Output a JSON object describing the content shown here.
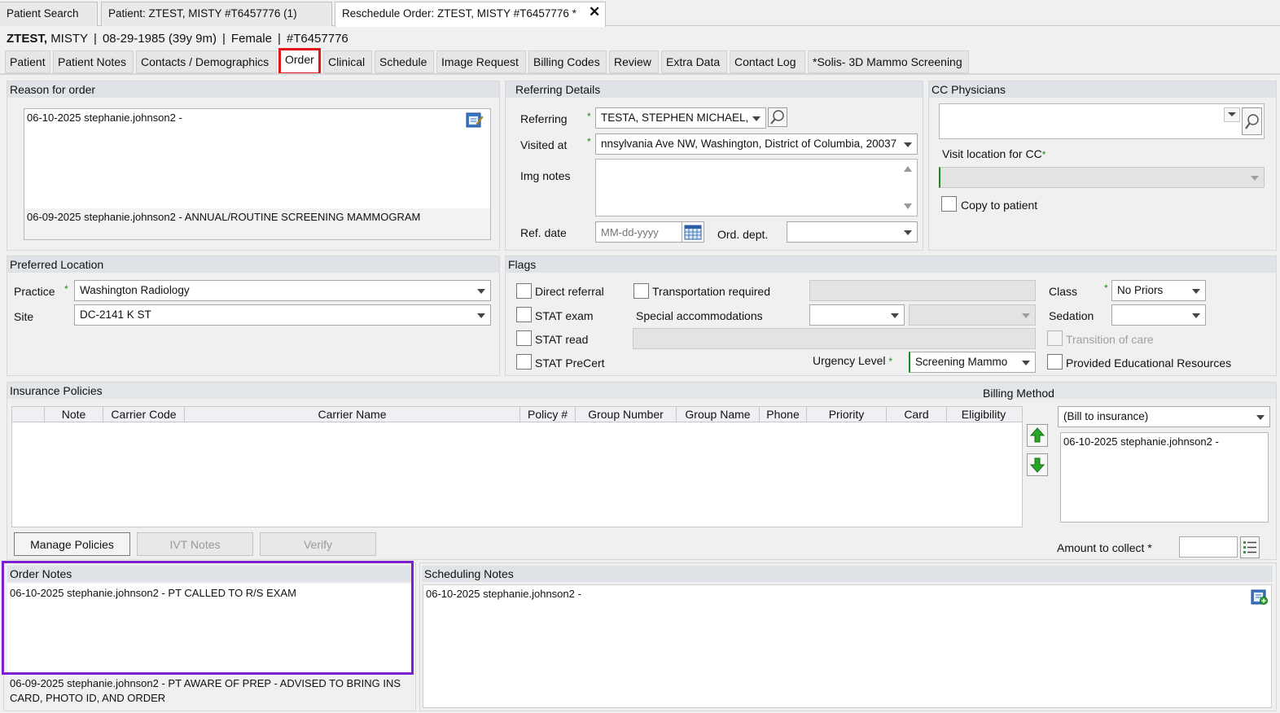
{
  "doc_tabs": [
    "Patient Search",
    "Patient: ZTEST, MISTY #T6457776 (1)",
    "Reschedule Order: ZTEST, MISTY #T6457776 *"
  ],
  "patient": {
    "last": "ZTEST,",
    "first": "MISTY",
    "dob": "08-29-1985 (39y 9m)",
    "sex": "Female",
    "id": "#T6457776",
    "sep": "|"
  },
  "sub_tabs": [
    "Patient",
    "Patient Notes",
    "Contacts / Demographics",
    "Order",
    "Clinical",
    "Schedule",
    "Image Request",
    "Billing Codes",
    "Review",
    "Extra Data",
    "Contact Log",
    "*Solis- 3D Mammo Screening"
  ],
  "reason": {
    "title": "Reason for order",
    "note1": "06-10-2025 stephanie.johnson2 -",
    "note2": "06-09-2025 stephanie.johnson2 - ANNUAL/ROUTINE SCREENING MAMMOGRAM"
  },
  "referring": {
    "title": "Referring Details",
    "referring_label": "Referring",
    "referring_value": "TESTA, STEPHEN MICHAEL,",
    "visited_label": "Visited at",
    "visited_value": "nnsylvania Ave NW, Washington, District of Columbia, 20037",
    "img_notes_label": "Img notes",
    "ref_date_label": "Ref. date",
    "ref_date_placeholder": "MM-dd-yyyy",
    "ord_dept_label": "Ord. dept."
  },
  "cc": {
    "title": "CC Physicians",
    "visit_location_label": "Visit location for CC",
    "copy_label": "Copy to patient"
  },
  "preferred": {
    "title": "Preferred Location",
    "practice_label": "Practice",
    "practice_value": "Washington Radiology",
    "site_label": "Site",
    "site_value": "DC-2141 K ST"
  },
  "flags": {
    "title": "Flags",
    "direct_referral": "Direct referral",
    "transportation": "Transportation required",
    "stat_exam": "STAT exam",
    "special": "Special accommodations",
    "stat_read": "STAT read",
    "stat_precert": "STAT PreCert",
    "urgency_label": "Urgency Level",
    "urgency_value": "Screening Mammo",
    "class_label": "Class",
    "class_value": "No Priors",
    "sedation_label": "Sedation",
    "transition": "Transition of care",
    "educational": "Provided Educational Resources"
  },
  "insurance": {
    "title": "Insurance Policies",
    "columns": [
      "",
      "Note",
      "Carrier Code",
      "Carrier Name",
      "Policy #",
      "Group Number",
      "Group Name",
      "Phone",
      "Priority",
      "Card",
      "Eligibility"
    ],
    "billing_method_label": "Billing Method",
    "billing_method_value": "(Bill to insurance)",
    "billing_note": "06-10-2025 stephanie.johnson2 -",
    "manage_btn": "Manage Policies",
    "ivt_btn": "IVT Notes",
    "verify_btn": "Verify",
    "amount_label": "Amount to collect *"
  },
  "order_notes": {
    "title": "Order Notes",
    "note1": "06-10-2025 stephanie.johnson2 - PT CALLED TO R/S EXAM",
    "note2_line1": "06-09-2025 stephanie.johnson2 - PT AWARE OF PREP - ADVISED TO BRING INS",
    "note2_line2": "CARD, PHOTO ID, AND ORDER"
  },
  "scheduling_notes": {
    "title": "Scheduling Notes",
    "note1": "06-10-2025 stephanie.johnson2 -"
  },
  "colors": {
    "selected_tab_border": "#e0171b",
    "order_notes_highlight": "#7b1fd1",
    "required": "#1b8a1b"
  }
}
